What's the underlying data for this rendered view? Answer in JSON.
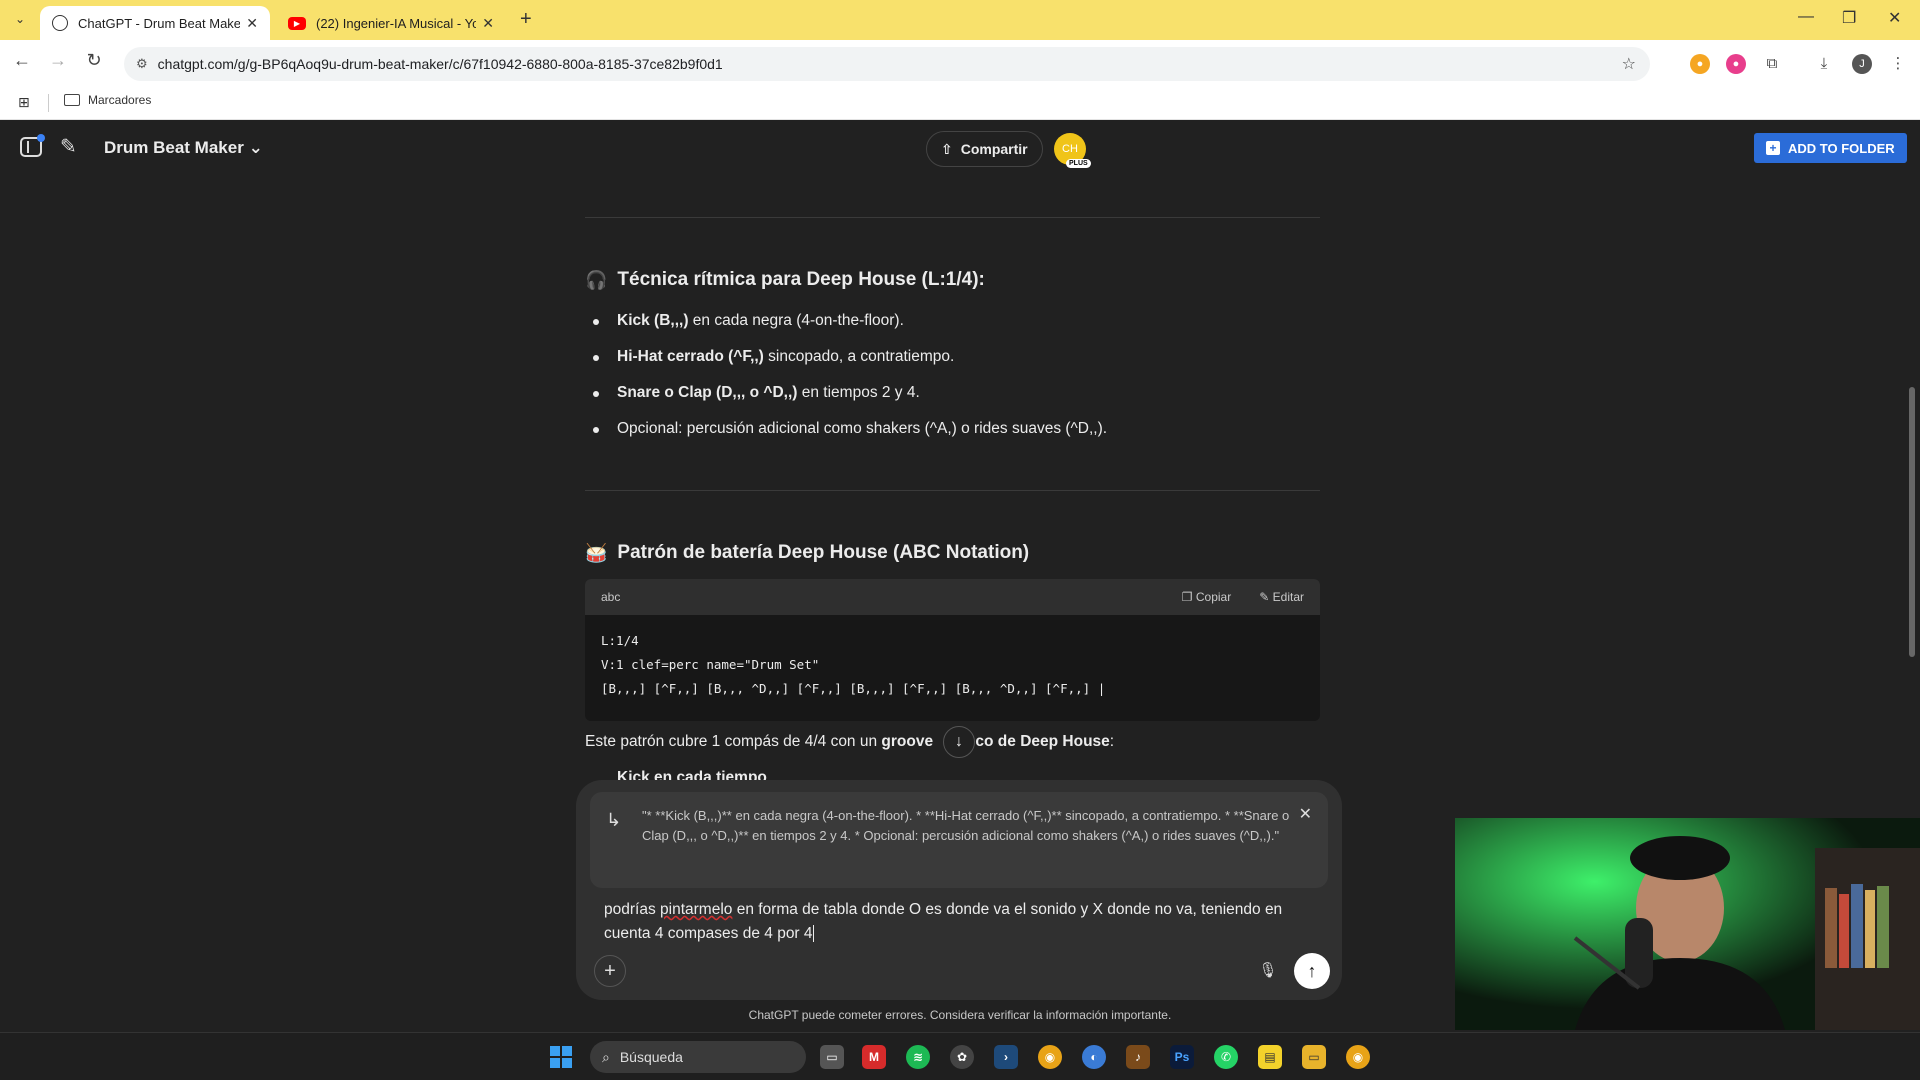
{
  "browser": {
    "tabs": [
      {
        "title": "ChatGPT - Drum Beat Maker",
        "active": true,
        "icon": "openai-icon"
      },
      {
        "title": "(22) Ingenier-IA Musical - YouTube",
        "active": false,
        "icon": "youtube-icon"
      }
    ],
    "url": "chatgpt.com/g/g-BP6qAoq9u-drum-beat-maker/c/67f10942-6880-800a-8185-37ce82b9f0d1",
    "bookmarks_folder": "Marcadores"
  },
  "header": {
    "gpt_name": "Drum Beat Maker",
    "share_label": "Compartir",
    "avatar_initials": "CH",
    "plan_badge": "PLUS",
    "add_to_folder_label": "ADD TO FOLDER"
  },
  "conversation": {
    "section1": {
      "emoji": "🎧",
      "heading": "Técnica rítmica para Deep House (L:1/4):",
      "bullets": [
        {
          "bold": "Kick (B,,,)",
          "text": " en cada negra (4-on-the-floor)."
        },
        {
          "bold": "Hi-Hat cerrado (^F,,)",
          "text": " sincopado, a contratiempo."
        },
        {
          "bold": "Snare o Clap (D,,, o ^D,,)",
          "text": " en tiempos 2 y 4."
        },
        {
          "bold": "",
          "text": "Opcional: percusión adicional como shakers (^A,) o rides suaves (^D,,)."
        }
      ]
    },
    "section2": {
      "emoji": "🥁",
      "heading": "Patrón de batería Deep House (ABC Notation)"
    },
    "code": {
      "language": "abc",
      "copy_label": "Copiar",
      "edit_label": "Editar",
      "lines": [
        "L:1/4",
        "V:1 clef=perc name=\"Drum Set\"",
        "[B,,,] [^F,,] [B,,, ^D,,] [^F,,] [B,,,] [^F,,] [B,,, ^D,,] [^F,,] |"
      ]
    },
    "after_code": {
      "pre": "Este patrón cubre 1 compás de 4/4 con un ",
      "bold1": "groove ",
      "bold2": "co de Deep House",
      "post": ":"
    },
    "partial_bullet": "Kick en cada tiempo"
  },
  "composer": {
    "quoted_text": "\"* **Kick (B,,,)** en cada negra (4-on-the-floor). * **Hi-Hat cerrado (^F,,)** sincopado, a contratiempo. * **Snare o Clap (D,,, o ^D,,)** en tiempos 2 y 4. * Opcional: percusión adicional como shakers (^A,) o rides suaves (^D,,).\"",
    "prompt_pre": "podrías ",
    "prompt_misspelled": "pintarmelo",
    "prompt_post": " en forma de tabla donde O es donde va el sonido y X donde no va, teniendo en cuenta 4 compases de 4 por 4"
  },
  "disclaimer": "ChatGPT puede cometer errores. Considera verificar la información importante.",
  "taskbar": {
    "search_label": "Búsqueda"
  }
}
